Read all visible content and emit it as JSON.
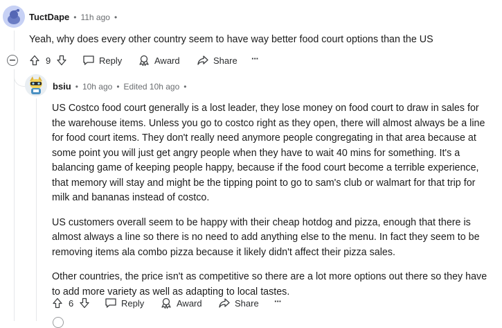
{
  "comment1": {
    "username": "TuctDape",
    "time": "11h ago",
    "dot": "•",
    "text": "Yeah, why does every other country seem to have way better food court options than the US",
    "actions": {
      "votes": "9",
      "reply": "Reply",
      "award": "Award",
      "share": "Share",
      "more": "···"
    }
  },
  "comment2": {
    "username": "bsiu",
    "time": "10h ago",
    "edited": "Edited 10h ago",
    "dot": "•",
    "paragraphs": [
      "US Costco food court generally is a lost leader, they lose money on food court to draw in sales for the warehouse items. Unless you go to costco right as they open, there will almost always be a line for food court items. They don't really need anymore people congregating in that area because at some point you will just get angry people when they have to wait 40 mins for something. It's a balancing game of keeping people happy, because if the food court become a terrible experience, that memory will stay and might be the tipping point to go to sam's club or walmart for that trip for milk and bananas instead of costco.",
      "US customers overall seem to be happy with their cheap hotdog and pizza, enough that there is almost always a line so there is no need to add anything else to the menu. In fact they seem to be removing items ala combo pizza because it likely didn't affect their pizza sales.",
      "Other countries, the price isn't as competitive so there are a lot more options out there so they have to add more variety as well as adapting to local tastes."
    ],
    "actions": {
      "votes": "6",
      "reply": "Reply",
      "award": "Award",
      "share": "Share",
      "more": "···"
    }
  }
}
